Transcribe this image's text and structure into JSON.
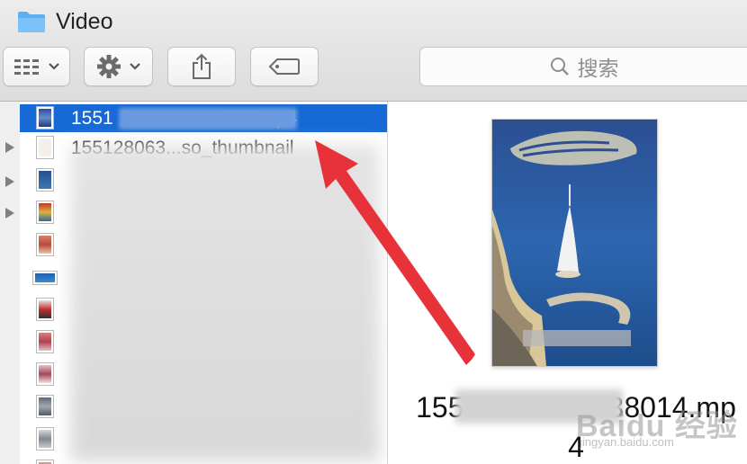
{
  "window": {
    "title": "Video"
  },
  "toolbar": {
    "view_icon": "icon-grid-icon",
    "action_icon": "gear-icon",
    "share_icon": "share-icon",
    "tags_icon": "tag-icon"
  },
  "search": {
    "placeholder": "搜索",
    "icon": "magnifier-icon"
  },
  "file_list": {
    "selected_name": "1551                     014.mp4",
    "second_name": "155128063...so_thumbnail",
    "selection_color": "#1769d5"
  },
  "preview": {
    "filename": "155                  38014.mp4"
  },
  "annotation": {
    "arrow_color": "#e8323a"
  },
  "watermark": {
    "logo": "Baidu 经验",
    "url": "jingyan.baidu.com"
  }
}
